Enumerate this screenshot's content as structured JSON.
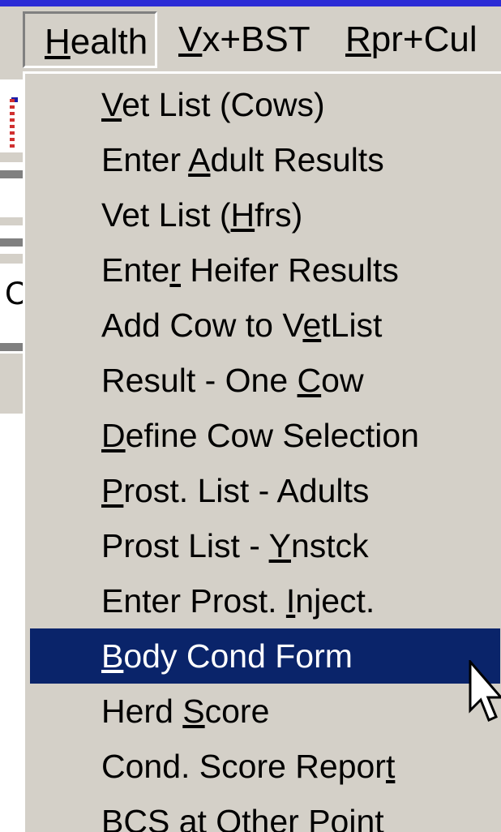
{
  "menubar": {
    "items": [
      {
        "label": "Health",
        "mnemonic": "H"
      },
      {
        "label": "Vx+BST",
        "mnemonic": "V"
      },
      {
        "label": "Rpr+Cul",
        "mnemonic": "R"
      }
    ]
  },
  "dropdown": {
    "items": [
      {
        "label": "Vet List (Cows)",
        "mnemonic_index": 0
      },
      {
        "label": "Enter Adult Results",
        "mnemonic_index": 6
      },
      {
        "label": "Vet List (Hfrs)",
        "mnemonic_index": 10
      },
      {
        "label": "Enter Heifer Results",
        "mnemonic_index": 4
      },
      {
        "label": "Add Cow to VetList",
        "mnemonic_index": 12
      },
      {
        "label": "Result - One Cow",
        "mnemonic_index": 13
      },
      {
        "label": "Define Cow Selection",
        "mnemonic_index": 0
      },
      {
        "label": "Prost. List - Adults",
        "mnemonic_index": 0
      },
      {
        "label": "Prost List - Ynstck",
        "mnemonic_index": 13
      },
      {
        "label": "Enter Prost. Inject.",
        "mnemonic_index": 13
      },
      {
        "label": "Body Cond Form",
        "mnemonic_index": 0
      },
      {
        "label": "Herd Score",
        "mnemonic_index": 5
      },
      {
        "label": "Cond. Score Report",
        "mnemonic_index": 17
      },
      {
        "label": "BCS at Other Point",
        "mnemonic_index": -1
      }
    ],
    "highlighted_index": 10
  },
  "under": {
    "letter": "C"
  },
  "colors": {
    "desktop": "#2b2bd6",
    "menu_face": "#d4d0c8",
    "highlight": "#0a246a",
    "highlight_text": "#ffffff"
  },
  "cursor": {
    "icon": "arrow-cursor-icon"
  }
}
